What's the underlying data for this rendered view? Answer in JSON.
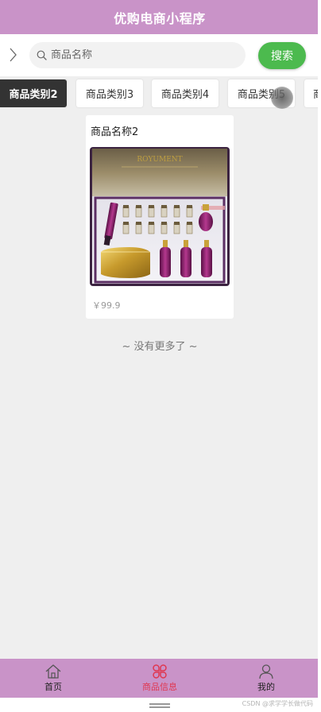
{
  "header": {
    "title": "优购电商小程序"
  },
  "search": {
    "placeholder": "商品名称",
    "value": "",
    "button_label": "搜索"
  },
  "categories": [
    {
      "label": "商品类别2",
      "active": true
    },
    {
      "label": "商品类别3",
      "active": false
    },
    {
      "label": "商品类别4",
      "active": false
    },
    {
      "label": "商品类别5",
      "active": false
    },
    {
      "label": "商",
      "active": false
    }
  ],
  "products": [
    {
      "name": "商品名称2",
      "price": "￥99.9",
      "image": "cosmetics-gift-box"
    }
  ],
  "list_footer": "~ 没有更多了 ~",
  "tabbar": {
    "items": [
      {
        "label": "首页",
        "icon": "home-icon",
        "active": false,
        "color": "#222222"
      },
      {
        "label": "商品信息",
        "icon": "grid-flower-icon",
        "active": true,
        "color": "#e0364f"
      },
      {
        "label": "我的",
        "icon": "user-icon",
        "active": false,
        "color": "#222222"
      }
    ]
  },
  "watermark": "CSDN @求学学长做代码",
  "colors": {
    "header_bg": "#c993c8",
    "search_button": "#4cba4e",
    "active_category_bg": "#333333",
    "tab_active": "#e0364f",
    "page_bg": "#efefef"
  }
}
